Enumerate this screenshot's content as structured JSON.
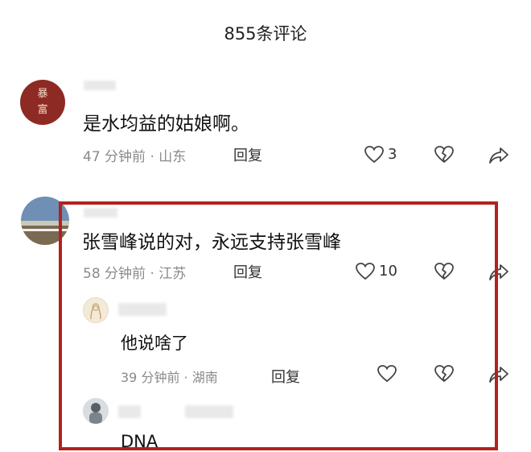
{
  "header": {
    "title": "855条评论"
  },
  "comments": [
    {
      "avatar_text": [
        "暴",
        "富"
      ],
      "text": "是水均益的姑娘啊。",
      "time": "47 分钟前 · 山东",
      "reply_label": "回复",
      "likes": "3"
    },
    {
      "text": "张雪峰说的对，永远支持张雪峰",
      "time": "58 分钟前 · 江苏",
      "reply_label": "回复",
      "likes": "10",
      "replies": [
        {
          "text": "他说啥了",
          "time": "39 分钟前 · 湖南",
          "reply_label": "回复"
        },
        {
          "text": "DNA"
        }
      ]
    }
  ],
  "icons": [
    "heart-icon",
    "broken-heart-icon",
    "share-icon"
  ],
  "colors": {
    "highlight_border": "#b3211f",
    "seal_avatar": "#8e2a24"
  }
}
